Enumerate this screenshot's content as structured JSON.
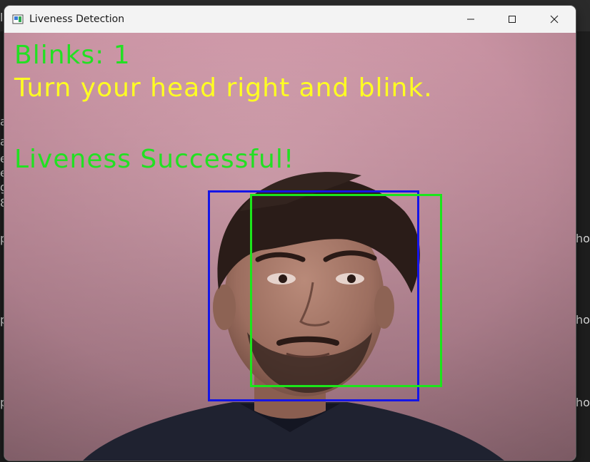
{
  "window": {
    "title": "Liveness Detection",
    "icon": "opencv-window-icon",
    "controls": [
      "minimize-icon",
      "maximize-icon",
      "close-icon"
    ]
  },
  "overlay": {
    "blinks_text": "Blinks: 1",
    "instruction_text": "Turn your head right and blink.",
    "status_text": "Liveness Successful!",
    "colors": {
      "blinks": "#22e022",
      "instruction": "#ffff22",
      "status": "#22e022",
      "face_box_a": "#1515e6",
      "face_box_b": "#1be61b"
    }
  },
  "camera_feed": {
    "background": "pink-wall",
    "subject": "person-face"
  },
  "background_fragments": [
    "li",
    "a",
    "a",
    "e",
    "e",
    "g",
    "8",
    "p",
    "p",
    "p",
    "ho",
    "ho",
    "ho"
  ]
}
